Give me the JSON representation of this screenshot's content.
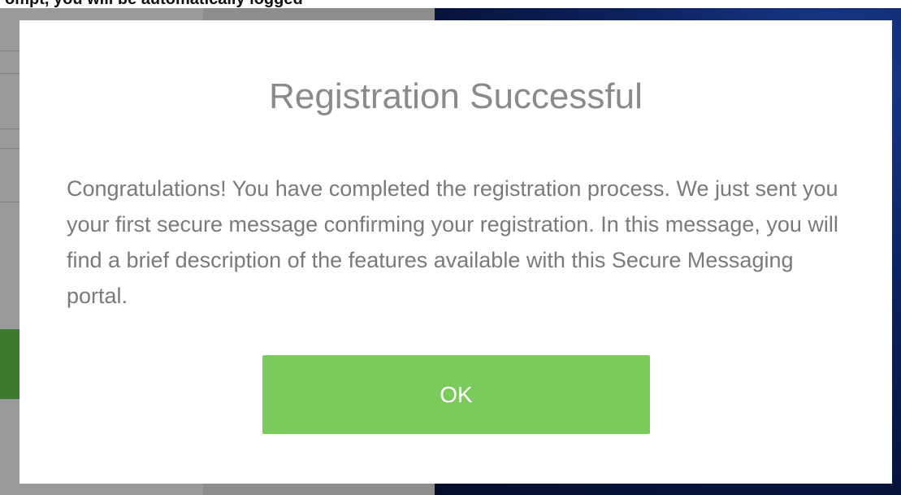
{
  "background": {
    "top_strip_text": "ompt, you will be automatically logged",
    "left_color": "#8d8d8d",
    "right_color": "#0d2260",
    "green_accent": "#3d7a2e"
  },
  "modal": {
    "title": "Registration Successful",
    "body": "Congratulations! You have completed the registration process. We just sent you your first secure message confirming your registration. In this message, you will find a brief description of the features available with this Secure Messaging portal.",
    "ok_label": "OK",
    "button_color": "#7bcb5c",
    "title_color": "#8a8a8a",
    "body_color": "#7a7a7a"
  }
}
